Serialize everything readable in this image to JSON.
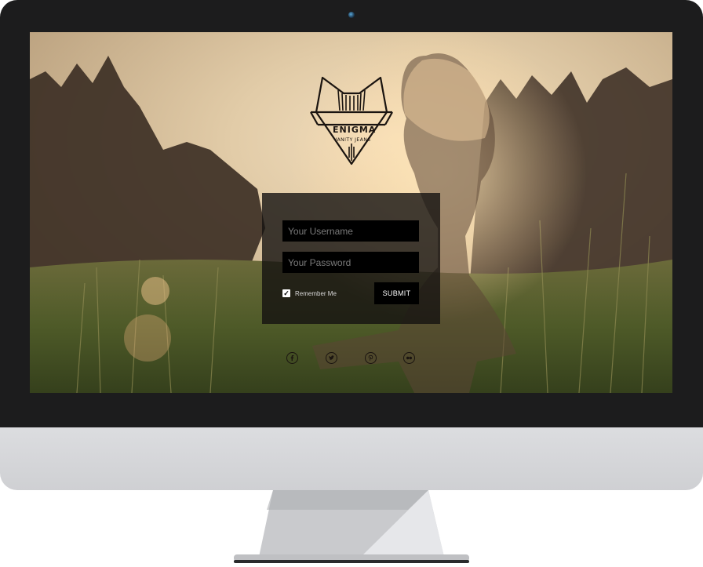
{
  "logo": {
    "title": "ENIGMA",
    "subtitle": "VANITY JEANS"
  },
  "login": {
    "username_placeholder": "Your Username",
    "password_placeholder": "Your Password",
    "remember_label": "Remember Me",
    "remember_checked": true,
    "submit_label": "SUBMIT"
  },
  "social": [
    {
      "icon": "facebook-icon"
    },
    {
      "icon": "twitter-icon"
    },
    {
      "icon": "pinterest-icon"
    },
    {
      "icon": "flickr-icon"
    }
  ],
  "colors": {
    "bezel": "#1c1c1d",
    "chin": "#d4d5d8",
    "panel": "#141210",
    "field": "#000000",
    "submit": "#000000"
  }
}
